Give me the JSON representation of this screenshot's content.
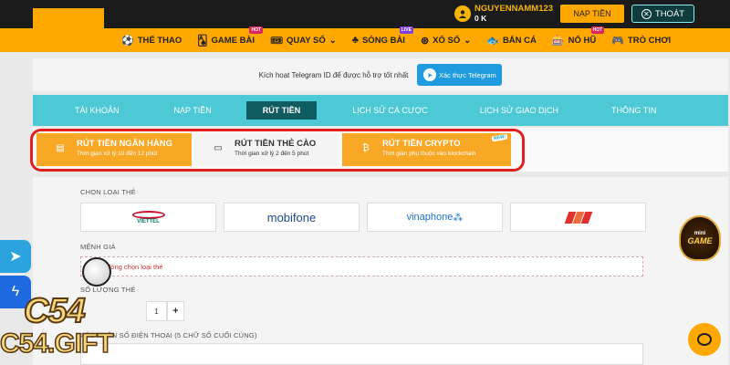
{
  "header": {
    "username": "NGUYENNAMM123",
    "balance": "0 K",
    "deposit_label": "NẠP TIỀN",
    "logout_label": "THOÁT"
  },
  "nav": {
    "items": [
      {
        "label": "THỂ THAO",
        "icon": "soccer-icon"
      },
      {
        "label": "GAME BÀI",
        "icon": "cards-icon",
        "tag": "HOT"
      },
      {
        "label": "QUAY SỐ",
        "icon": "ticket-icon"
      },
      {
        "label": "SÒNG BÀI",
        "icon": "casino-icon",
        "tag": "LIVE"
      },
      {
        "label": "XỔ SỐ",
        "icon": "lottery-icon"
      },
      {
        "label": "BẮN CÁ",
        "icon": "fish-icon"
      },
      {
        "label": "NỔ HŨ",
        "icon": "slot-icon",
        "tag": "HOT"
      },
      {
        "label": "TRÒ CHƠI",
        "icon": "gamepad-icon"
      }
    ]
  },
  "telegram": {
    "text": "Kích hoạt Telegram ID để được hỗ trợ tốt nhất",
    "button": "Xác thực Telegram"
  },
  "tabs": [
    "TÀI KHOẢN",
    "NẠP TIỀN",
    "RÚT TIỀN",
    "LỊCH SỬ CÁ CƯỢC",
    "LỊCH SỬ GIAO DỊCH",
    "THÔNG TIN"
  ],
  "subtabs": [
    {
      "title": "RÚT TIỀN NGÂN HÀNG",
      "sub": "Thời gian xử lý 10 đến 12 phút"
    },
    {
      "title": "RÚT TIỀN THẺ CÀO",
      "sub": "Thời gian xử lý 2 đến 5 phút"
    },
    {
      "title": "RÚT TIỀN CRYPTO",
      "sub": "Thời gian phụ thuộc vào blockchain",
      "badge": "NEW!"
    }
  ],
  "form": {
    "card_type_label": "CHỌN LOẠI THẺ",
    "carriers": [
      "VIETTEL",
      "mobifone",
      "vinaphone"
    ],
    "denomination_label": "MỆNH GIÁ",
    "denomination_placeholder": "Vui lòng chọn loại thẻ",
    "quantity_label": "SỐ LƯỢNG THẺ",
    "quantity_value": "1",
    "plus": "+",
    "phone_label": "XÁC NHẬN SỐ ĐIỆN THOẠI (5 CHỮ SỐ CUỐI CÙNG)"
  },
  "watermark": {
    "big": "C54",
    "gift": "C54.GIFT"
  },
  "minigame": {
    "t1": "mini",
    "t2": "GAME"
  }
}
